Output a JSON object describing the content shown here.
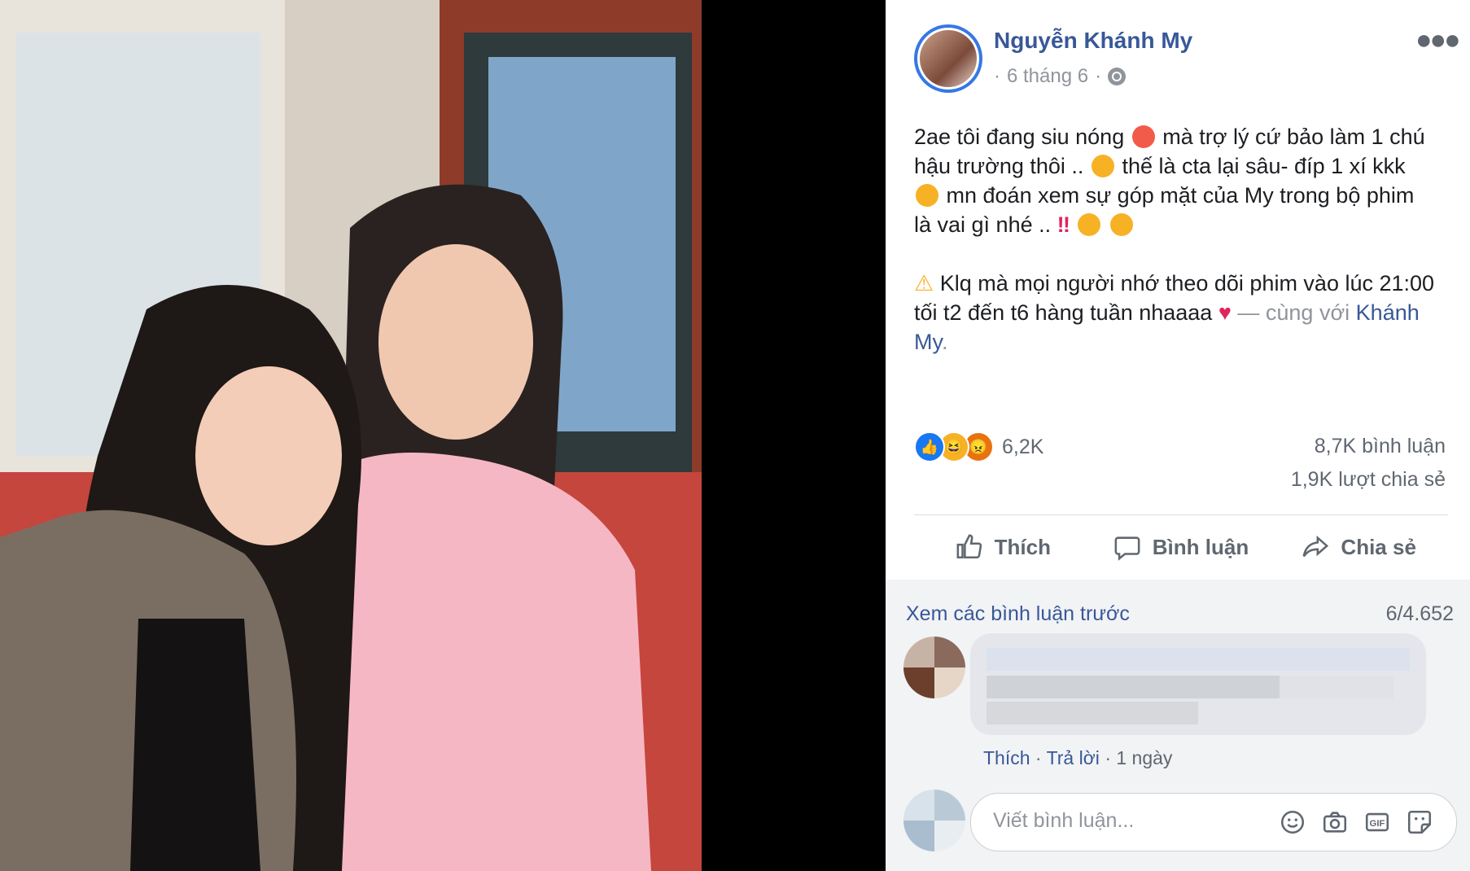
{
  "post": {
    "author": "Nguyễn Khánh My",
    "date": "6 tháng 6",
    "separator": "·",
    "text_1": "2ae tôi đang siu nóng",
    "text_2": "mà trợ lý cứ bảo làm 1 chú hậu trường thôi ..",
    "text_3": "thế là cta lại sâu- đíp 1 xí kkk",
    "text_4": "mn đoán xem sự góp mặt của My trong bộ phim là vai gì nhé ..",
    "text_5": "Klq mà mọi người nhớ theo dõi phim vào lúc 21:00 tối t2 đến t6 hàng tuần nhaaaa",
    "with_prefix": "— cùng với",
    "tagged": "Khánh My",
    "period": "."
  },
  "stats": {
    "reactions": "6,2K",
    "comments": "8,7K bình luận",
    "shares": "1,9K lượt chia sẻ"
  },
  "actions": {
    "like": "Thích",
    "comment": "Bình luận",
    "share": "Chia sẻ"
  },
  "comments": {
    "view_previous": "Xem các bình luận trước",
    "count": "6/4.652",
    "like": "Thích",
    "reply": "Trả lời",
    "time": "1 ngày",
    "dot": "·",
    "placeholder": "Viết bình luận..."
  },
  "colors": {
    "link": "#385898",
    "secondary_text": "#606770",
    "like_blue": "#1877f2",
    "haha_yellow": "#f7b125",
    "angry_orange": "#e9710f",
    "love_red": "#e0245e"
  }
}
